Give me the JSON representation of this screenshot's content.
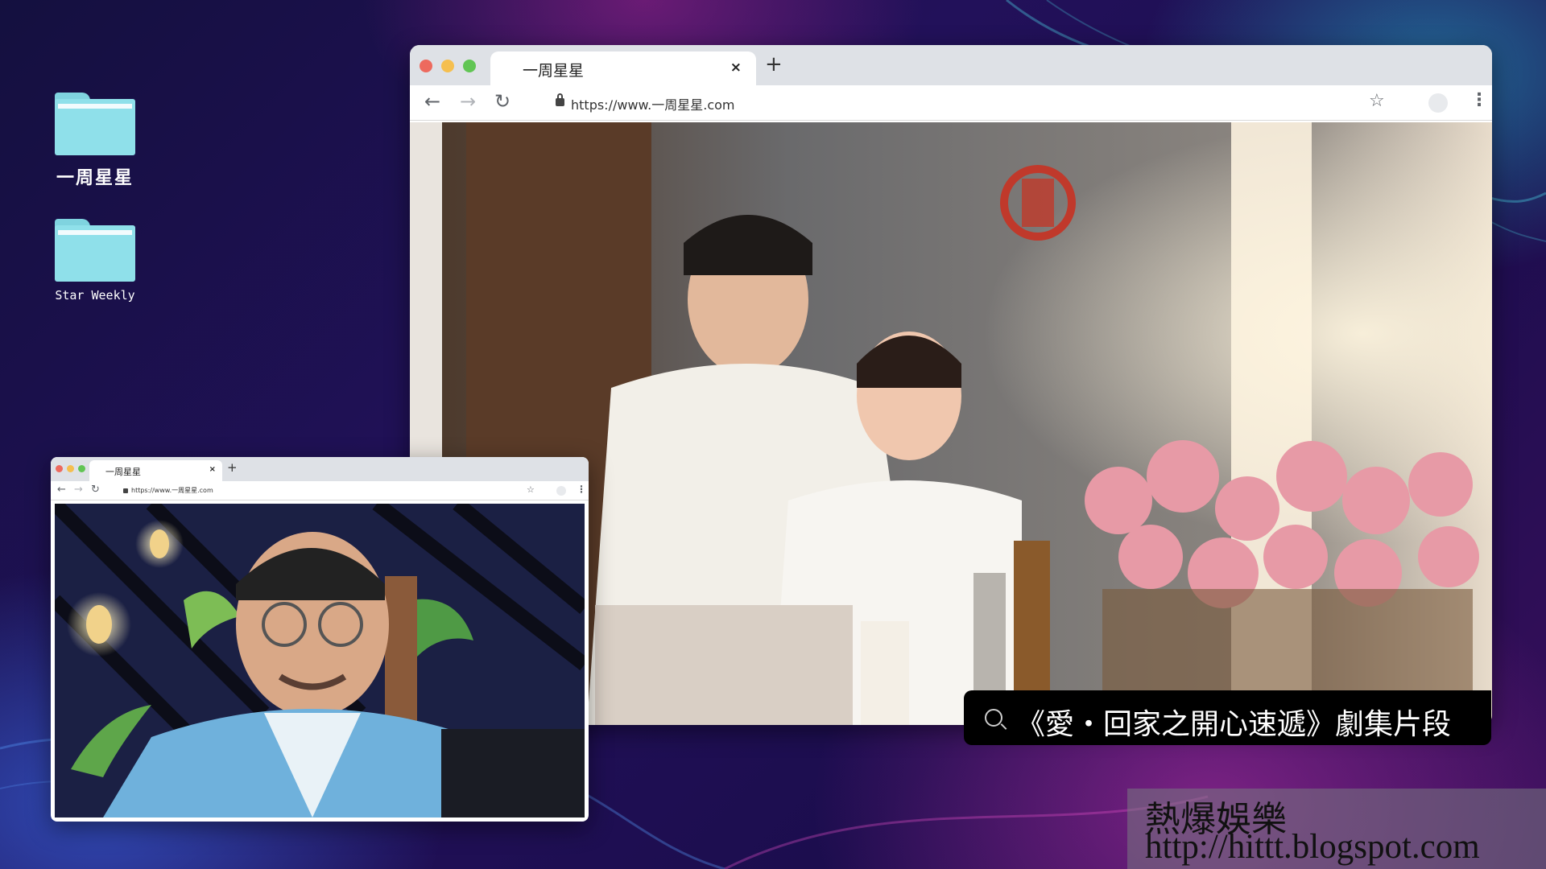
{
  "desktop": {
    "folders": [
      {
        "label": "一周星星"
      },
      {
        "label": "Star Weekly"
      }
    ]
  },
  "main_browser": {
    "tab_title": "一周星星",
    "tab_close": "×",
    "new_tab": "+",
    "url": "https://www.一周星星.com",
    "icons": {
      "back": "←",
      "forward": "→",
      "reload": "↻",
      "star": "☆",
      "menu": "⋮"
    }
  },
  "small_browser": {
    "tab_title": "一周星星",
    "tab_close": "×",
    "new_tab": "+",
    "url": "https://www.一周星星.com",
    "icons": {
      "back": "←",
      "forward": "→",
      "reload": "↻",
      "star": "☆",
      "menu": "⋮"
    }
  },
  "caption": {
    "text": "《愛・回家之開心速遞》劇集片段"
  },
  "watermark": {
    "line1": "熱爆娛樂",
    "line2": "http://hittt.blogspot.com"
  }
}
